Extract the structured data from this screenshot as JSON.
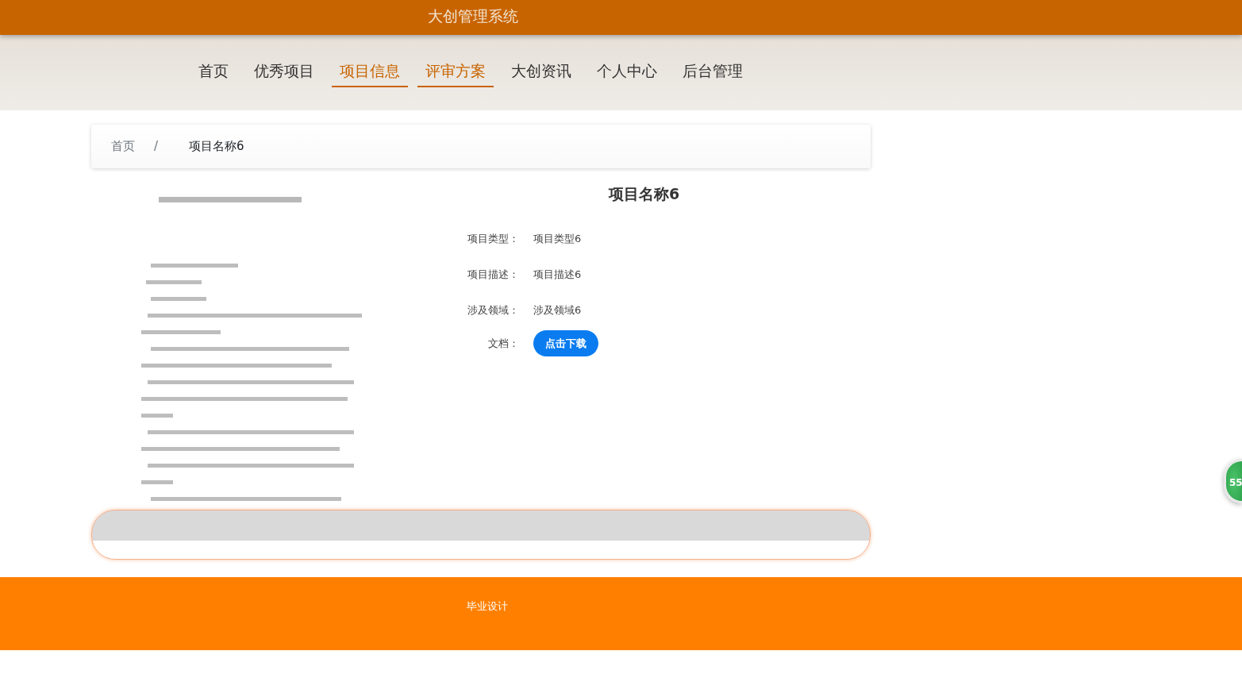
{
  "header": {
    "title": "大创管理系统"
  },
  "nav": [
    {
      "label": "首页",
      "selected": false
    },
    {
      "label": "优秀项目",
      "selected": false
    },
    {
      "label": "项目信息",
      "selected": true
    },
    {
      "label": "评审方案",
      "selected": true
    },
    {
      "label": "大创资讯",
      "selected": false
    },
    {
      "label": "个人中心",
      "selected": false
    },
    {
      "label": "后台管理",
      "selected": false
    }
  ],
  "breadcrumb": [
    "首页",
    "项目名称6"
  ],
  "breadcrumb_separator": "/",
  "project": {
    "title": "项目名称6",
    "fields": [
      {
        "label": "项目类型：",
        "value": "项目类型6",
        "kind": "text"
      },
      {
        "label": "项目描述：",
        "value": "项目描述6",
        "kind": "text"
      },
      {
        "label": "涉及领域：",
        "value": "涉及领域6",
        "kind": "text"
      },
      {
        "label": "文档：",
        "value": "点击下载",
        "kind": "button"
      }
    ]
  },
  "floating_badge": "55",
  "footer": {
    "text": "毕业设计"
  }
}
